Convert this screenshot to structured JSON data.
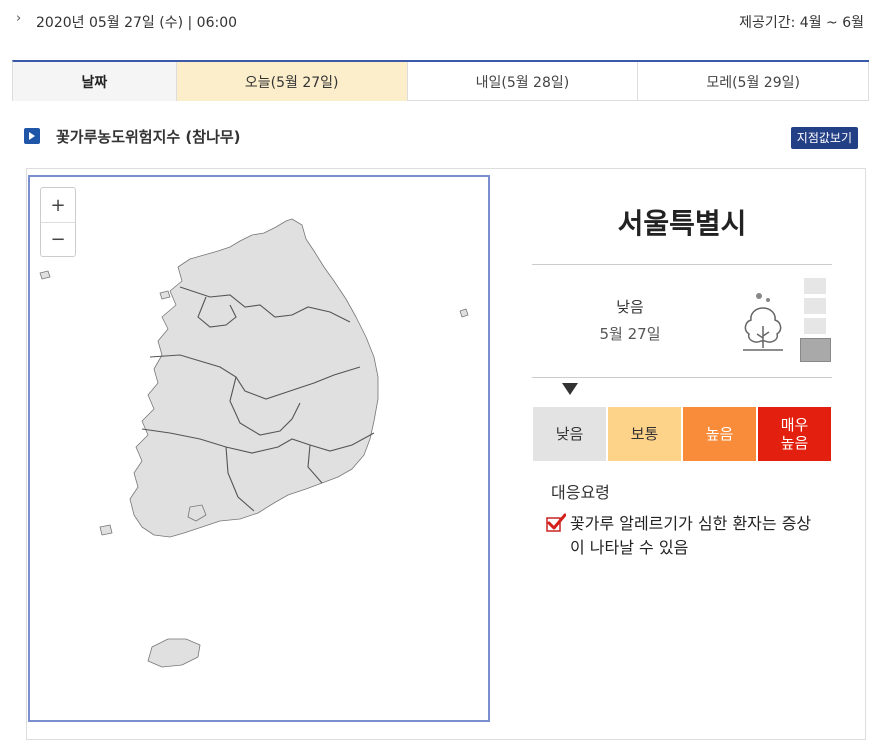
{
  "header": {
    "datetime": "2020년 05월 27일 (수) | 06:00",
    "period": "제공기간: 4월 ~ 6월"
  },
  "tabs": {
    "label": "날짜",
    "items": [
      {
        "label": "오늘(5월 27일)",
        "active": true
      },
      {
        "label": "내일(5월 28일)",
        "active": false
      },
      {
        "label": "모레(5월 29일)",
        "active": false
      }
    ]
  },
  "section": {
    "title": "꽃가루농도위험지수 (참나무)",
    "point_button": "지점값보기"
  },
  "map": {
    "zoom_in": "+",
    "zoom_out": "−",
    "fill": "#e0e0e0",
    "stroke": "#555555"
  },
  "detail": {
    "region": "서울특별시",
    "grade": "낮음",
    "date": "5월 27일",
    "icon": "tree-icon",
    "level_index": 0
  },
  "legend": [
    {
      "label": "낮음",
      "color": "#e3e3e3"
    },
    {
      "label": "보통",
      "color": "#fdd38a"
    },
    {
      "label": "높음",
      "color": "#f98c3a"
    },
    {
      "label": "매우\n높음",
      "color": "#e3200f"
    }
  ],
  "response": {
    "title": "대응요령",
    "items": [
      "꽃가루 알레르기가 심한 환자는 증상이 나타날 수 있음"
    ]
  }
}
